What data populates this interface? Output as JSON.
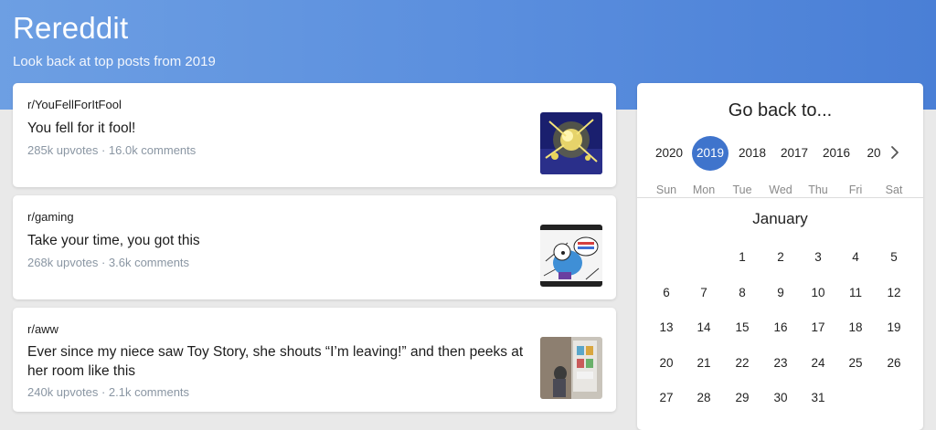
{
  "header": {
    "title": "Rereddit",
    "subtitle": "Look back at top posts from 2019"
  },
  "posts": [
    {
      "subreddit": "r/YouFellForItFool",
      "title": "You fell for it fool!",
      "meta": "285k upvotes · 16.0k comments",
      "thumbnail": "glowing-explosion-image"
    },
    {
      "subreddit": "r/gaming",
      "title": "Take your time, you got this",
      "meta": "268k upvotes · 3.6k comments",
      "thumbnail": "cartoon-character-press-button-image"
    },
    {
      "subreddit": "r/aww",
      "title": "Ever since my niece saw Toy Story, she shouts “I’m leaving!” and then peeks at her room like this",
      "meta": "240k upvotes · 2.1k comments",
      "thumbnail": "child-at-doorway-photo"
    }
  ],
  "calendar": {
    "heading": "Go back to...",
    "years": [
      "2020",
      "2019",
      "2018",
      "2017",
      "2016",
      "20"
    ],
    "selected_year": "2019",
    "next_icon": "chevron-right-icon",
    "weekdays": [
      "Sun",
      "Mon",
      "Tue",
      "Wed",
      "Thu",
      "Fri",
      "Sat"
    ],
    "month": "January",
    "days": [
      "1",
      "2",
      "3",
      "4",
      "5",
      "6",
      "7",
      "8",
      "9",
      "10",
      "11",
      "12",
      "13",
      "14",
      "15",
      "16",
      "17",
      "18",
      "19",
      "20",
      "21",
      "22",
      "23",
      "24",
      "25",
      "26",
      "27",
      "28",
      "29",
      "30",
      "31"
    ]
  },
  "colors": {
    "header_gradient_start": "#6d9fe3",
    "header_gradient_end": "#4a7fd6",
    "selected_year_bg": "#3f74cc",
    "meta_text": "#8a96a3",
    "page_bg": "#e9e9e9"
  }
}
